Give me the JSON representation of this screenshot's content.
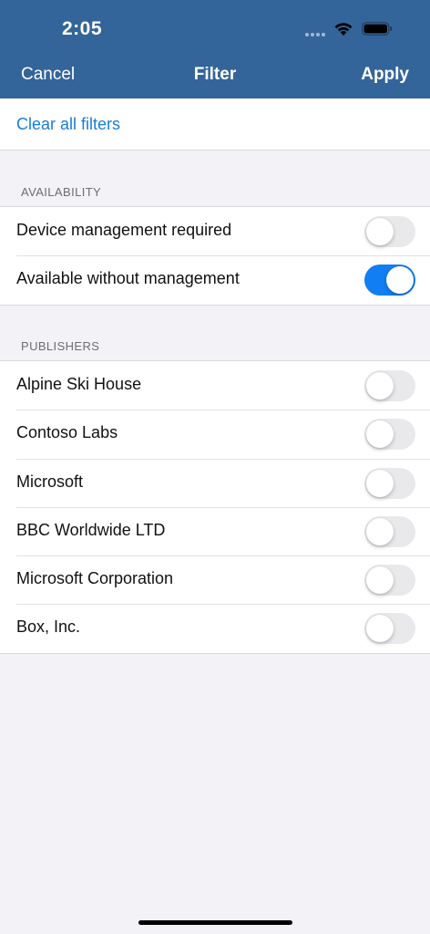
{
  "status_bar": {
    "time": "2:05",
    "icons": [
      "signal-icon",
      "wifi-icon",
      "battery-icon"
    ]
  },
  "nav": {
    "cancel_label": "Cancel",
    "title": "Filter",
    "apply_label": "Apply"
  },
  "clear_all_label": "Clear all filters",
  "availability": {
    "header": "AVAILABILITY",
    "items": [
      {
        "label": "Device management required",
        "on": false
      },
      {
        "label": "Available without management",
        "on": true
      }
    ]
  },
  "publishers": {
    "header": "PUBLISHERS",
    "items": [
      {
        "label": "Alpine Ski House",
        "on": false
      },
      {
        "label": "Contoso Labs",
        "on": false
      },
      {
        "label": "Microsoft",
        "on": false
      },
      {
        "label": "BBC Worldwide LTD",
        "on": false
      },
      {
        "label": "Microsoft Corporation",
        "on": false
      },
      {
        "label": "Box, Inc.",
        "on": false
      }
    ]
  },
  "colors": {
    "header_bg": "#34659a",
    "accent": "#117ef3",
    "link": "#1a7cd8",
    "background": "#f2f2f7"
  }
}
